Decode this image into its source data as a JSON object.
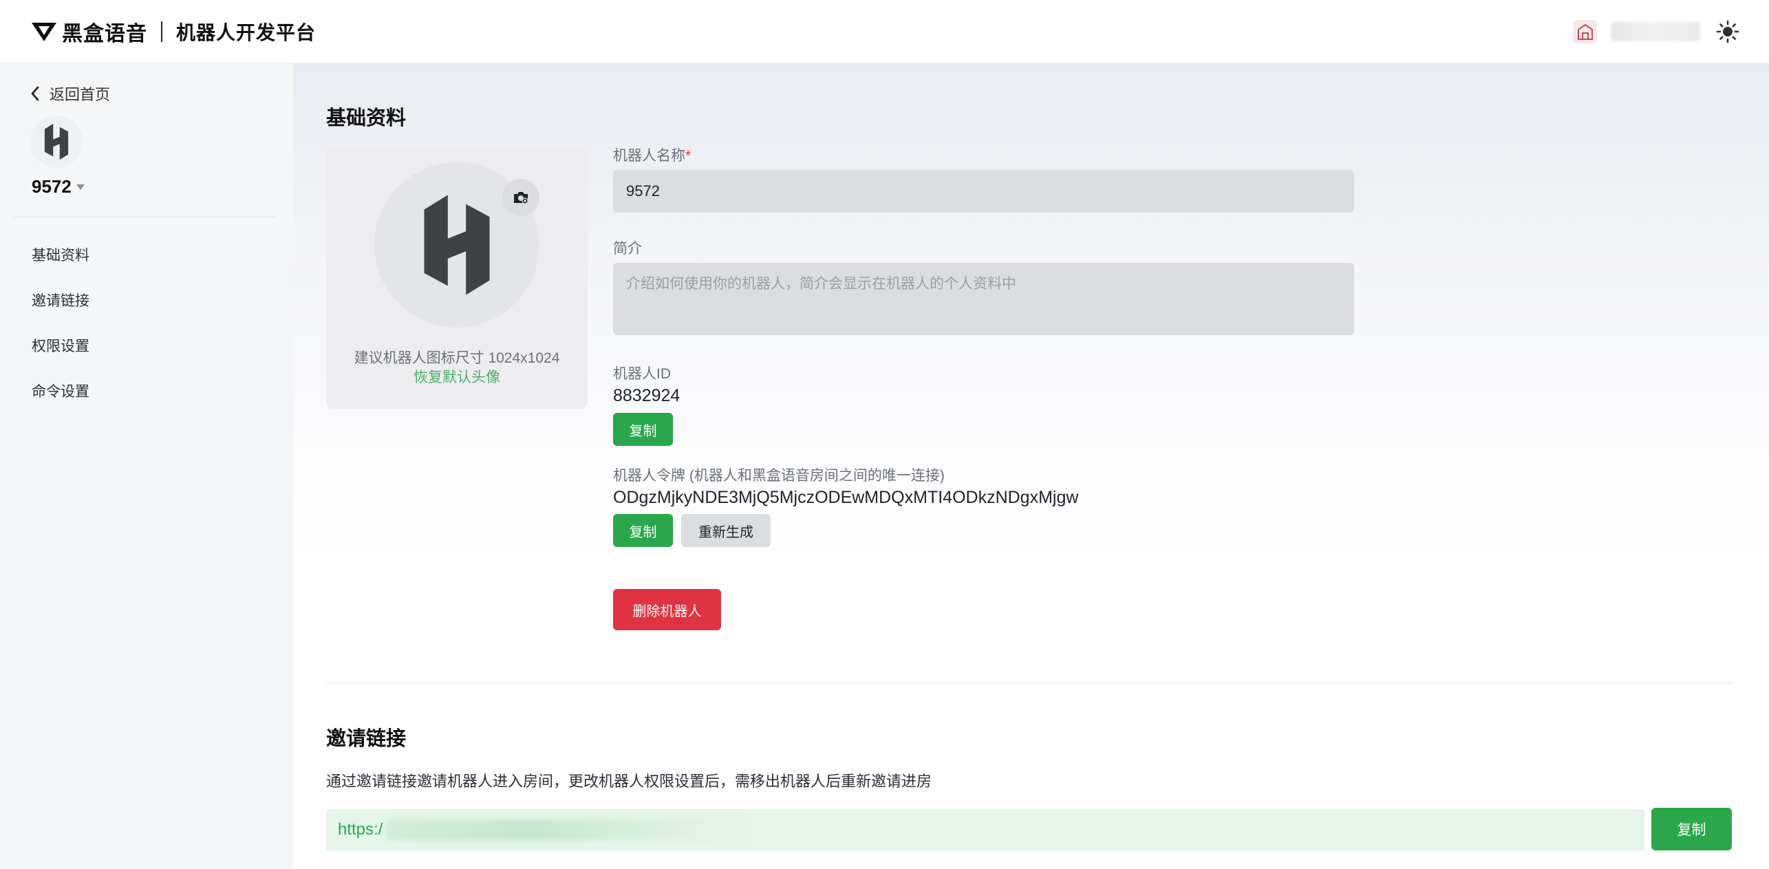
{
  "header": {
    "brand": "黑盒语音",
    "platform": "机器人开发平台"
  },
  "sidebar": {
    "back_label": "返回首页",
    "bot_name": "9572",
    "items": [
      {
        "label": "基础资料"
      },
      {
        "label": "邀请链接"
      },
      {
        "label": "权限设置"
      },
      {
        "label": "命令设置"
      }
    ]
  },
  "basic": {
    "section_title": "基础资料",
    "avatar_hint": "建议机器人图标尺寸 1024x1024",
    "avatar_reset": "恢复默认头像",
    "name_label": "机器人名称",
    "name_required_mark": "*",
    "name_value": "9572",
    "intro_label": "简介",
    "intro_placeholder": "介绍如何使用你的机器人，简介会显示在机器人的个人资料中",
    "id_label": "机器人ID",
    "id_value": "8832924",
    "copy_label": "复制",
    "token_label": "机器人令牌 (机器人和黑盒语音房间之间的唯一连接)",
    "token_value": "ODgzMjkyNDE3MjQ5MjczODEwMDQxMTI4ODkzNDgxMjgw",
    "regenerate_label": "重新生成",
    "delete_label": "删除机器人"
  },
  "invite": {
    "section_title": "邀请链接",
    "description": "通过邀请链接邀请机器人进入房间，更改机器人权限设置后，需移出机器人后重新邀请进房",
    "link_prefix": "https:/",
    "copy_label": "复制"
  },
  "colors": {
    "accent_green": "#2aa74a",
    "danger_red": "#e03341",
    "link_bg": "#e5f5e9"
  }
}
